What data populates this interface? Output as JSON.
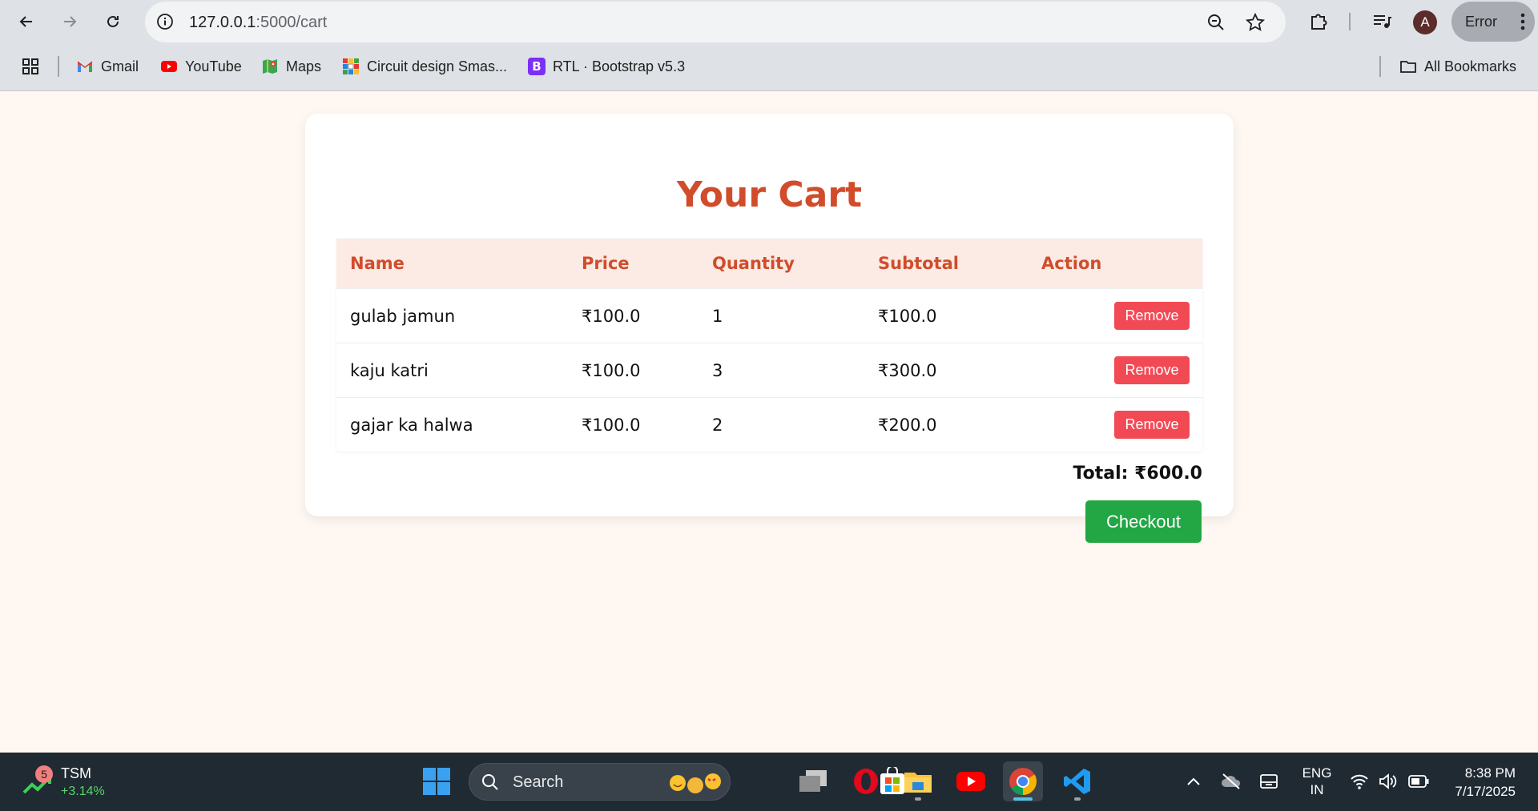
{
  "browser": {
    "url_host": "127.0.0.1",
    "url_path": ":5000/cart",
    "profile_initial": "A",
    "error_label": "Error",
    "bookmarks": [
      {
        "label": "Gmail",
        "icon": "gmail-icon"
      },
      {
        "label": "YouTube",
        "icon": "youtube-icon"
      },
      {
        "label": "Maps",
        "icon": "maps-icon"
      },
      {
        "label": "Circuit design Smas...",
        "icon": "circuit-icon"
      },
      {
        "label": "RTL · Bootstrap v5.3",
        "icon": "bootstrap-icon"
      }
    ],
    "all_bookmarks_label": "All Bookmarks"
  },
  "page": {
    "title": "Your Cart",
    "columns": [
      "Name",
      "Price",
      "Quantity",
      "Subtotal",
      "Action"
    ],
    "items": [
      {
        "name": "gulab jamun",
        "price": "₹100.0",
        "quantity": "1",
        "subtotal": "₹100.0",
        "action": "Remove"
      },
      {
        "name": "kaju katri",
        "price": "₹100.0",
        "quantity": "3",
        "subtotal": "₹300.0",
        "action": "Remove"
      },
      {
        "name": "gajar ka halwa",
        "price": "₹100.0",
        "quantity": "2",
        "subtotal": "₹200.0",
        "action": "Remove"
      }
    ],
    "total": "Total: ₹600.0",
    "checkout_label": "Checkout"
  },
  "taskbar": {
    "stock_symbol": "TSM",
    "stock_change": "+3.14%",
    "stock_badge": "5",
    "search_placeholder": "Search",
    "lang_line1": "ENG",
    "lang_line2": "IN",
    "time": "8:38 PM",
    "date": "7/17/2025"
  },
  "colors": {
    "accent": "#d14c2b",
    "header_bg": "#fbebe4",
    "remove": "#f24a55",
    "checkout": "#22a744",
    "page_bg": "#fff8f2"
  }
}
